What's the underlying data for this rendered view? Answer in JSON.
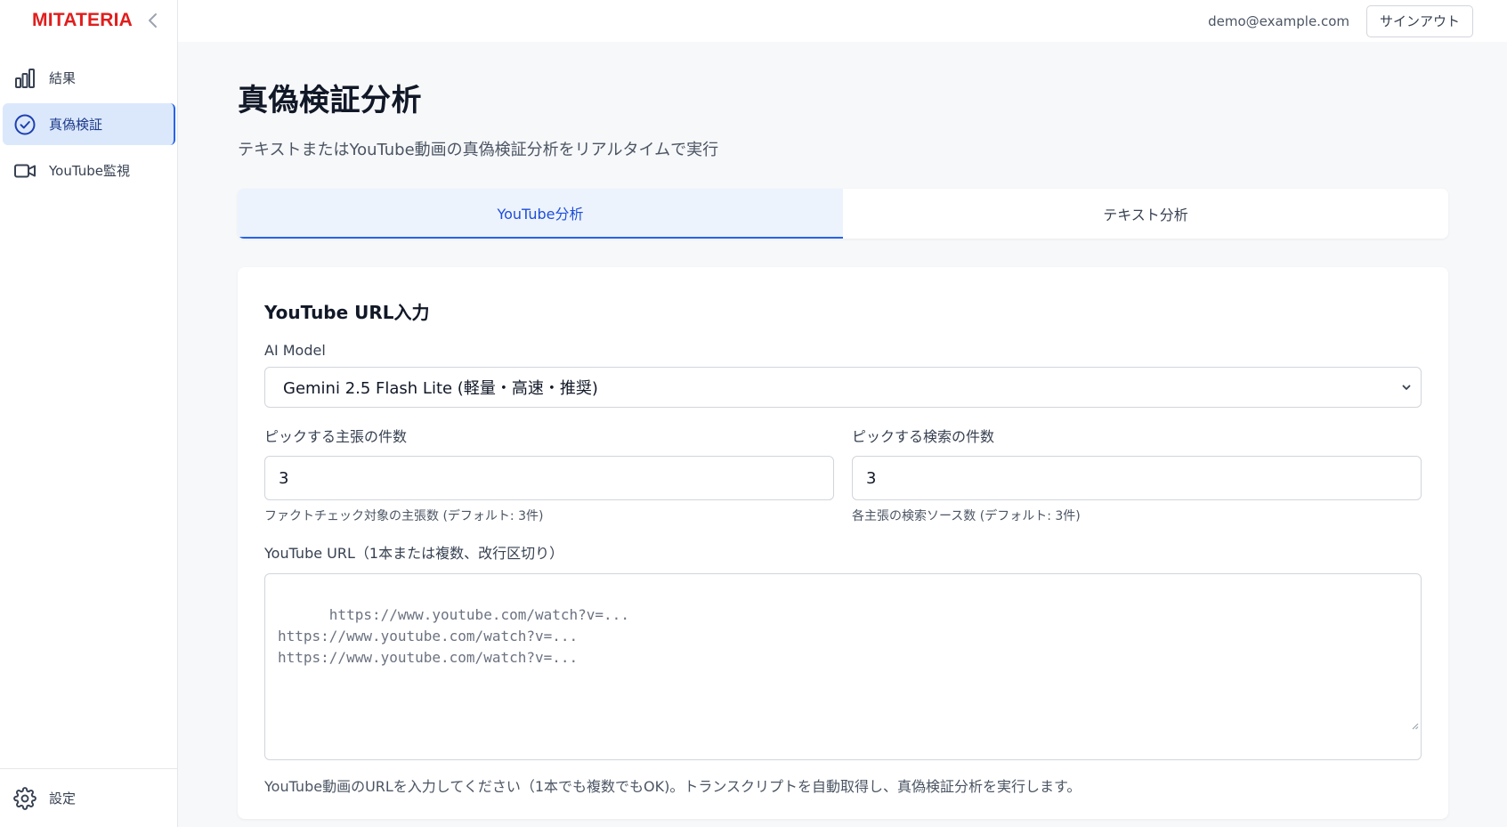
{
  "brand": {
    "name": "MITATERIA",
    "color": "#e11d1d"
  },
  "sidebar": {
    "items": [
      {
        "label": "結果",
        "icon": "bar-chart-icon"
      },
      {
        "label": "真偽検証",
        "icon": "check-circle-icon",
        "active": true
      },
      {
        "label": "YouTube監視",
        "icon": "video-camera-icon"
      }
    ],
    "settings_label": "設定"
  },
  "header": {
    "email": "demo@example.com",
    "signout_label": "サインアウト"
  },
  "page": {
    "title": "真偽検証分析",
    "subtitle": "テキストまたはYouTube動画の真偽検証分析をリアルタイムで実行"
  },
  "tabs": [
    {
      "label": "YouTube分析",
      "active": true
    },
    {
      "label": "テキスト分析",
      "active": false
    }
  ],
  "form": {
    "card_title": "YouTube URL入力",
    "model_label": "AI Model",
    "model_value": "Gemini 2.5 Flash Lite (軽量・高速・推奨)",
    "claims_label": "ピックする主張の件数",
    "claims_value": "3",
    "claims_help": "ファクトチェック対象の主張数 (デフォルト: 3件)",
    "search_label": "ピックする検索の件数",
    "search_value": "3",
    "search_help": "各主張の検索ソース数 (デフォルト: 3件)",
    "url_label": "YouTube URL（1本または複数、改行区切り）",
    "url_placeholder": "https://www.youtube.com/watch?v=...\nhttps://www.youtube.com/watch?v=...\nhttps://www.youtube.com/watch?v=...",
    "url_help": "YouTube動画のURLを入力してください（1本でも複数でもOK)。トランスクリプトを自動取得し、真偽検証分析を実行します。"
  },
  "colors": {
    "accent": "#2563eb",
    "active_bg": "#dbe8fc"
  }
}
